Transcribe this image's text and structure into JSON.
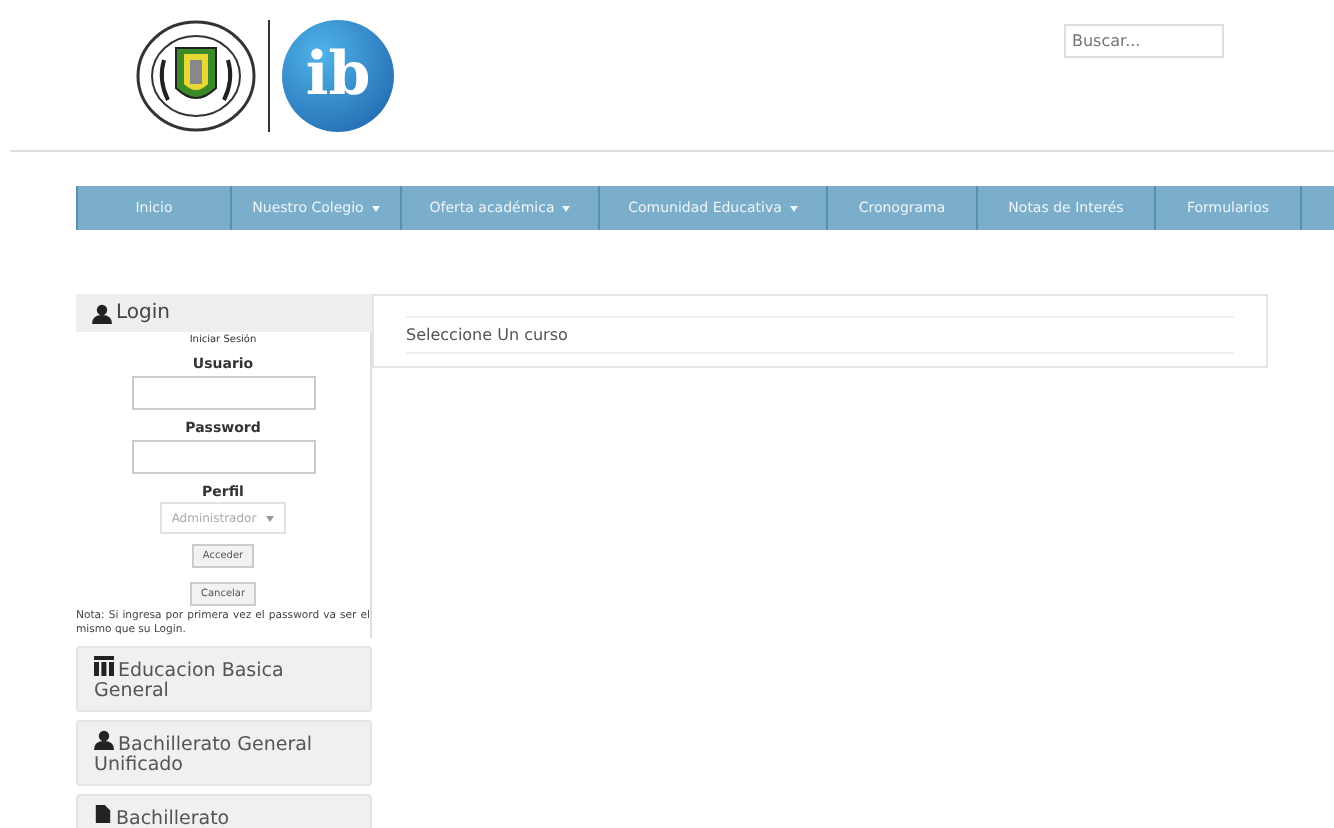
{
  "header": {
    "logo_text": "ib",
    "search": {
      "placeholder": "Buscar..."
    }
  },
  "nav": [
    {
      "label": "Inicio",
      "dropdown": false
    },
    {
      "label": "Nuestro Colegio",
      "dropdown": true
    },
    {
      "label": "Oferta académica",
      "dropdown": true
    },
    {
      "label": "Comunidad Educativa",
      "dropdown": true
    },
    {
      "label": "Cronograma",
      "dropdown": false
    },
    {
      "label": "Notas de Interés",
      "dropdown": false
    },
    {
      "label": "Formularios",
      "dropdown": false
    }
  ],
  "login": {
    "title": "Login",
    "subtitle": "Iniciar Sesión",
    "user_label": "Usuario",
    "password_label": "Password",
    "profile_label": "Perfil",
    "profile_value": "Administrador",
    "buttons": [
      "Acceder",
      "Cancelar"
    ],
    "note": "Nota: Si ingresa por primera vez el password va ser el mismo que su Login."
  },
  "categories": [
    {
      "kind": "grid",
      "label": "Educacion Basica General"
    },
    {
      "kind": "user",
      "label": "Bachillerato General Unificado"
    },
    {
      "kind": "file",
      "label": "Bachillerato"
    }
  ],
  "main": {
    "heading": "Seleccione Un curso"
  }
}
